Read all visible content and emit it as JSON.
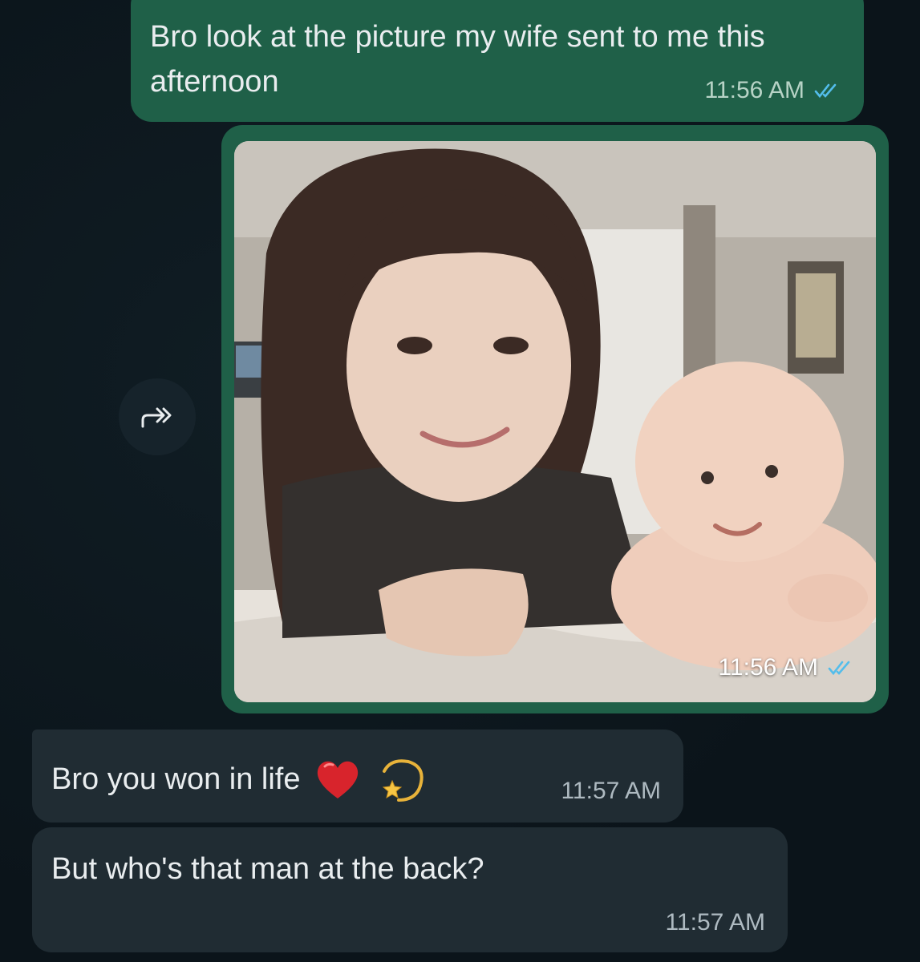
{
  "messages": {
    "outgoing_text": {
      "text": "Bro look at the picture my wife sent to me this afternoon",
      "time": "11:56 AM",
      "status": "read-double-check"
    },
    "outgoing_image": {
      "time": "11:56 AM",
      "status": "read-double-check"
    },
    "incoming_1": {
      "text": "Bro you won in life",
      "emojis": [
        "red-heart-icon",
        "dizzy-star-icon"
      ],
      "time": "11:57 AM"
    },
    "incoming_2": {
      "text": "But who's that man at the back?",
      "time": "11:57 AM"
    }
  },
  "colors": {
    "background": "#0b141a",
    "outgoing_bubble": "#1f6048",
    "incoming_bubble": "#202c33",
    "read_tick": "#53bdeb",
    "text": "#e9edef"
  },
  "icons": {
    "forward": "forward-icon",
    "ticks": "double-check-icon"
  }
}
